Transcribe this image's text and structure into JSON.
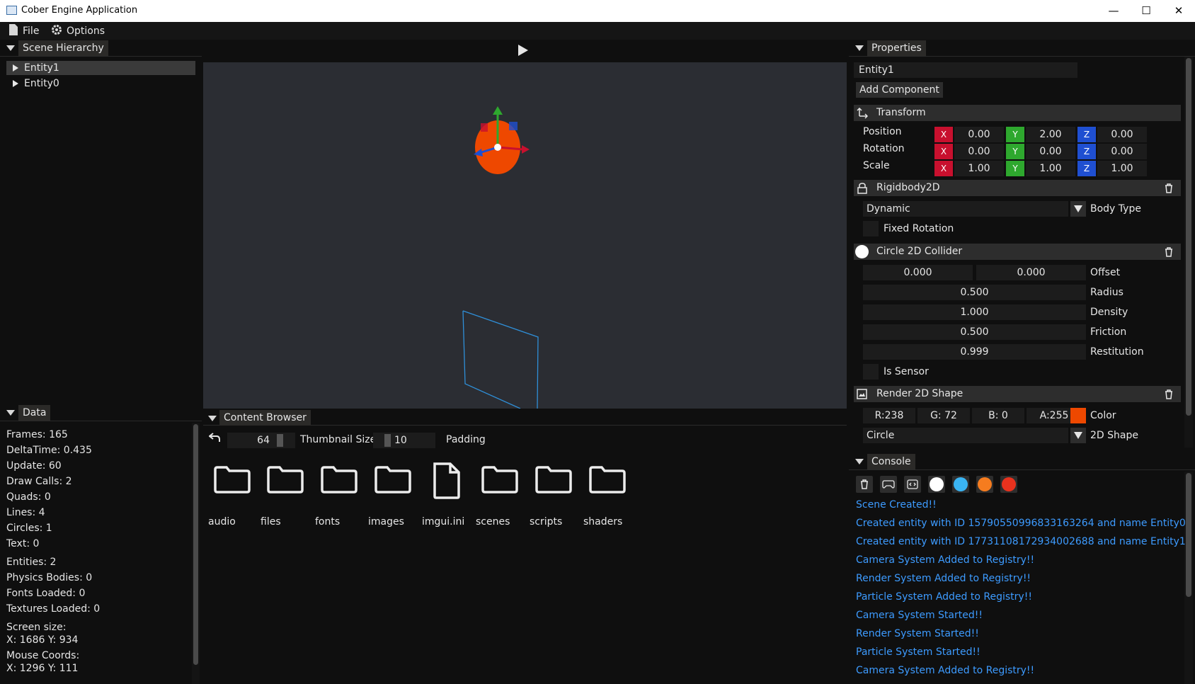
{
  "window": {
    "title": "Cober Engine Application",
    "minimize": "—",
    "maximize": "☐",
    "close": "✕"
  },
  "menu": {
    "file": "File",
    "options": "Options"
  },
  "hierarchy": {
    "tab": "Scene Hierarchy",
    "items": [
      "Entity1",
      "Entity0"
    ]
  },
  "data_panel": {
    "tab": "Data",
    "lines": [
      "Frames: 165",
      "DeltaTime: 0.435",
      "Update: 60",
      "Draw Calls: 2",
      "Quads: 0",
      "Lines: 4",
      "Circles: 1",
      "Text: 0"
    ],
    "lines2": [
      "Entities: 2",
      "Physics Bodies: 0",
      "Fonts Loaded: 0",
      "Textures Loaded: 0"
    ],
    "screen_size_label": "Screen size:",
    "screen_size": "X: 1686 Y: 934",
    "mouse_label": "Mouse Coords:",
    "mouse": "X: 1296 Y: 111"
  },
  "viewport": {
    "play_icon": "play-icon"
  },
  "content_browser": {
    "tab": "Content Browser",
    "thumbnail_value": "64",
    "thumbnail_label": "Thumbnail Size",
    "padding_value": "10",
    "padding_label": "Padding",
    "items": [
      {
        "name": "audio",
        "icon": "folder-icon"
      },
      {
        "name": "files",
        "icon": "folder-icon"
      },
      {
        "name": "fonts",
        "icon": "folder-icon"
      },
      {
        "name": "images",
        "icon": "folder-icon"
      },
      {
        "name": "imgui.ini",
        "icon": "file-icon"
      },
      {
        "name": "scenes",
        "icon": "folder-icon"
      },
      {
        "name": "scripts",
        "icon": "folder-icon"
      },
      {
        "name": "shaders",
        "icon": "folder-icon"
      }
    ]
  },
  "properties": {
    "tab": "Properties",
    "entity_name": "Entity1",
    "add_component": "Add Component",
    "transform": {
      "title": "Transform",
      "rows": [
        {
          "label": "Position",
          "x": "0.00",
          "y": "2.00",
          "z": "0.00"
        },
        {
          "label": "Rotation",
          "x": "0.00",
          "y": "0.00",
          "z": "0.00"
        },
        {
          "label": "Scale",
          "x": "1.00",
          "y": "1.00",
          "z": "1.00"
        }
      ],
      "axis_x": "X",
      "axis_y": "Y",
      "axis_z": "Z"
    },
    "rigidbody": {
      "title": "Rigidbody2D",
      "body_type_value": "Dynamic",
      "body_type_label": "Body Type",
      "fixed_rotation_label": "Fixed Rotation"
    },
    "circle_collider": {
      "title": "Circle 2D Collider",
      "offset_x": "0.000",
      "offset_y": "0.000",
      "offset_label": "Offset",
      "radius": "0.500",
      "radius_label": "Radius",
      "density": "1.000",
      "density_label": "Density",
      "friction": "0.500",
      "friction_label": "Friction",
      "restitution": "0.999",
      "restitution_label": "Restitution",
      "is_sensor_label": "Is Sensor"
    },
    "render_shape": {
      "title": "Render 2D Shape",
      "r": "R:238",
      "g": "G: 72",
      "b": "B:  0",
      "a": "A:255",
      "color_label": "Color",
      "swatch": "#ee4800",
      "shape_value": "Circle",
      "shape_label": "2D Shape"
    }
  },
  "console": {
    "tab": "Console",
    "dot_colors": [
      "#ffffff",
      "#3ab4f2",
      "#f57c1f",
      "#e8321e"
    ],
    "lines": [
      "Scene Created!!",
      "Created entity with ID 15790550996833163264 and name Entity0",
      "Created entity with ID 17731108172934002688 and name Entity1",
      "Camera System Added to Registry!!",
      "Render System Added to Registry!!",
      "Particle System Added to Registry!!",
      "Camera System Started!!",
      "Render System Started!!",
      "Particle System Started!!",
      "Camera System Added to Registry!!"
    ]
  }
}
